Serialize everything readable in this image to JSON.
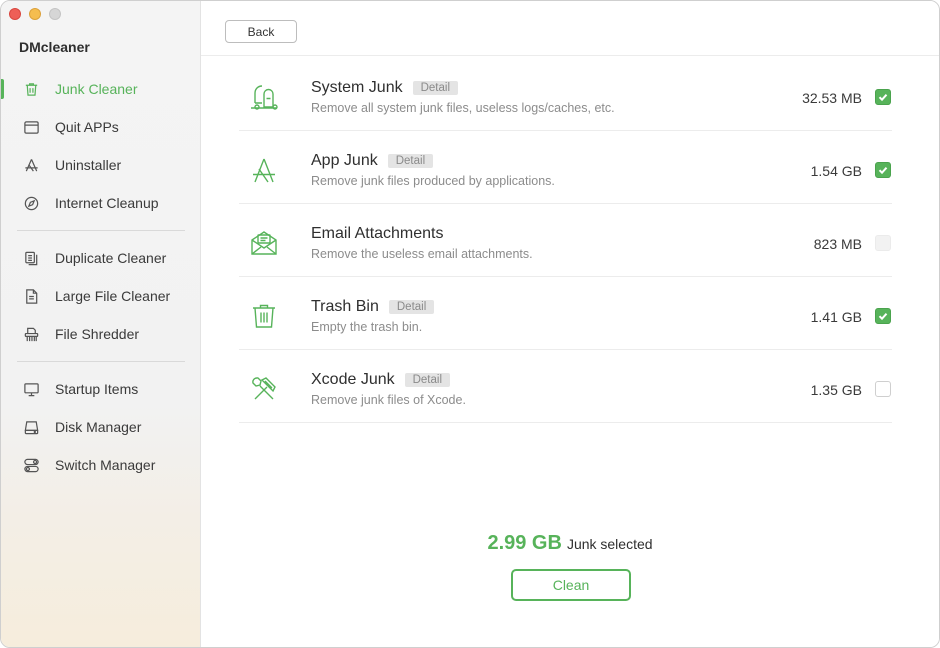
{
  "app": {
    "title": "DMcleaner"
  },
  "sidebar": {
    "items": [
      {
        "label": "Junk Cleaner",
        "icon": "trash-icon",
        "active": true
      },
      {
        "label": "Quit APPs",
        "icon": "window-icon"
      },
      {
        "label": "Uninstaller",
        "icon": "app-store-icon"
      },
      {
        "label": "Internet Cleanup",
        "icon": "compass-icon"
      },
      {
        "label": "Duplicate Cleaner",
        "icon": "duplicate-files-icon"
      },
      {
        "label": "Large File Cleaner",
        "icon": "document-icon"
      },
      {
        "label": "File Shredder",
        "icon": "shredder-icon"
      },
      {
        "label": "Startup Items",
        "icon": "monitor-icon"
      },
      {
        "label": "Disk Manager",
        "icon": "disk-icon"
      },
      {
        "label": "Switch Manager",
        "icon": "toggle-switch-icon"
      }
    ]
  },
  "toolbar": {
    "back_label": "Back"
  },
  "junk": {
    "items": [
      {
        "title": "System Junk",
        "detail": "Detail",
        "desc": "Remove all system junk files, useless logs/caches, etc.",
        "size": "32.53 MB",
        "checked": true,
        "icon": "vacuum-cleaner-icon"
      },
      {
        "title": "App Junk",
        "detail": "Detail",
        "desc": "Remove junk files produced by applications.",
        "size": "1.54 GB",
        "checked": true,
        "icon": "app-store-icon"
      },
      {
        "title": "Email Attachments",
        "detail": "",
        "desc": "Remove the useless email attachments.",
        "size": "823 MB",
        "checked": false,
        "disabled": true,
        "icon": "envelope-icon"
      },
      {
        "title": "Trash Bin",
        "detail": "Detail",
        "desc": "Empty the trash bin.",
        "size": "1.41 GB",
        "checked": true,
        "icon": "trash-bin-icon"
      },
      {
        "title": "Xcode Junk",
        "detail": "Detail",
        "desc": "Remove junk files of Xcode.",
        "size": "1.35 GB",
        "checked": false,
        "icon": "hammer-wrench-icon"
      }
    ]
  },
  "summary": {
    "amount": "2.99 GB",
    "text": "Junk selected"
  },
  "actions": {
    "clean_label": "Clean"
  },
  "colors": {
    "accent": "#57b35a",
    "detail_bg": "#e4e4e4"
  }
}
